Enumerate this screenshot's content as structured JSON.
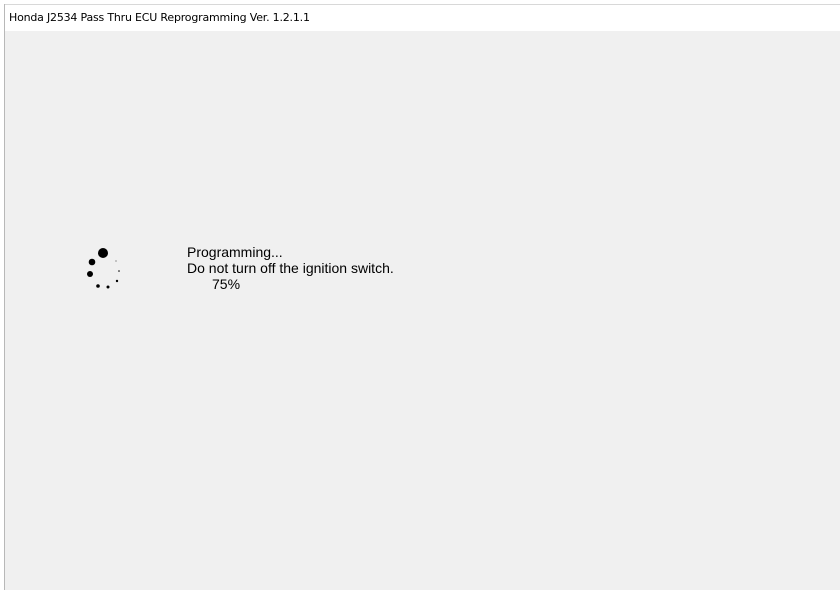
{
  "window": {
    "title": "Honda J2534 Pass Thru ECU Reprogramming Ver. 1.2.1.1"
  },
  "status": {
    "line1": "Programming...",
    "line2": "Do not turn off the ignition switch.",
    "percent": "75%"
  },
  "spinner": {
    "icon": "loading-spinner-icon",
    "color": "#000000"
  },
  "colors": {
    "background": "#f0f0f0",
    "titlebar": "#ffffff",
    "text": "#000000"
  }
}
